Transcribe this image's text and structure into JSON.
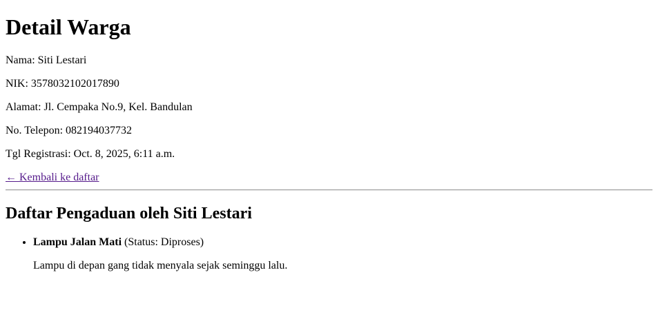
{
  "page": {
    "title": "Detail Warga"
  },
  "warga": {
    "nama_label": "Nama:",
    "nama": "Siti Lestari",
    "nik_label": "NIK:",
    "nik": "3578032102017890",
    "alamat_label": "Alamat:",
    "alamat": "Jl. Cempaka No.9, Kel. Bandulan",
    "telepon_label": "No. Telepon:",
    "telepon": "082194037732",
    "registrasi_label": "Tgl Registrasi:",
    "registrasi": "Oct. 8, 2025, 6:11 a.m."
  },
  "back_link": {
    "label": "← Kembali ke daftar"
  },
  "pengaduan": {
    "heading": "Daftar Pengaduan oleh Siti Lestari",
    "items": [
      {
        "title": "Lampu Jalan Mati",
        "status_text": "(Status: Diproses)",
        "description": "Lampu di depan gang tidak menyala sejak seminggu lalu."
      }
    ]
  }
}
